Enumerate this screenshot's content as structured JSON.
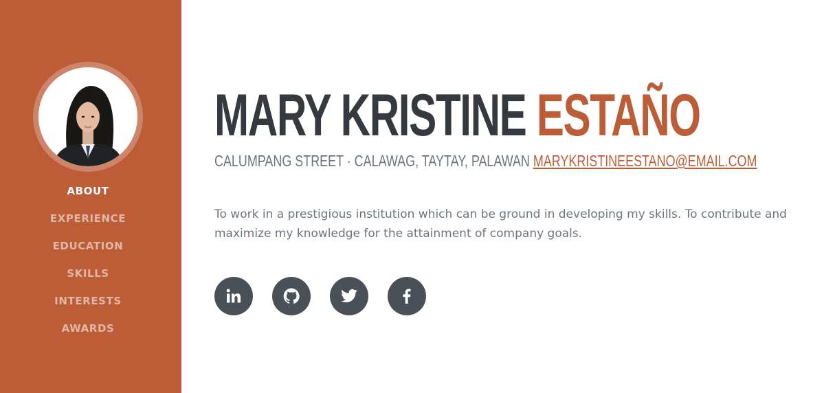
{
  "profile": {
    "photo_alt": "profile photo",
    "first_name": "MARY KRISTINE",
    "last_name": "ESTAÑO",
    "address": "CALUMPANG STREET · CALAWAG, TAYTAY, PALAWAN",
    "email": "MARYKRISTINEESTANO@EMAIL.COM",
    "objective": "To work in a prestigious institution which can be ground in developing my skills. To contribute and maximize my knowledge for the attainment of company goals."
  },
  "nav": {
    "items": [
      {
        "label": "About",
        "active": true
      },
      {
        "label": "Experience",
        "active": false
      },
      {
        "label": "Education",
        "active": false
      },
      {
        "label": "Skills",
        "active": false
      },
      {
        "label": "Interests",
        "active": false
      },
      {
        "label": "Awards",
        "active": false
      }
    ]
  },
  "social": {
    "icons": [
      "linkedin-icon",
      "github-icon",
      "twitter-icon",
      "facebook-icon"
    ]
  },
  "colors": {
    "sidebar": "#bd5d38",
    "accent": "#bd5d38",
    "heading": "#343a40",
    "text": "#6c757d",
    "social_bg": "#495057"
  }
}
